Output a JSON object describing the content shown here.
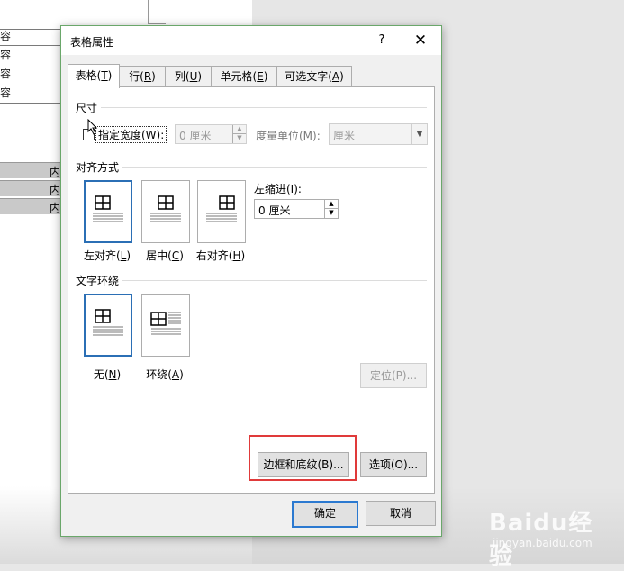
{
  "document": {
    "cells": [
      "容",
      "容",
      "容",
      "容"
    ],
    "gray_rows": [
      "内",
      "内",
      "内"
    ]
  },
  "dialog": {
    "title": "表格属性",
    "help": "?",
    "close": "✕",
    "tabs": [
      {
        "label": "表格",
        "mnemonic": "T"
      },
      {
        "label": "行",
        "mnemonic": "R"
      },
      {
        "label": "列",
        "mnemonic": "U"
      },
      {
        "label": "单元格",
        "mnemonic": "E"
      },
      {
        "label": "可选文字",
        "mnemonic": "A"
      }
    ],
    "size": {
      "section_label": "尺寸",
      "preferred_width_label": "指定宽度(W):",
      "preferred_width_checked": false,
      "width_value": "0 厘米",
      "unit_label": "度量单位(M):",
      "unit_value": "厘米"
    },
    "alignment": {
      "section_label": "对齐方式",
      "options": [
        {
          "label": "左对齐",
          "mnemonic": "L",
          "selected": true
        },
        {
          "label": "居中",
          "mnemonic": "C",
          "selected": false
        },
        {
          "label": "右对齐",
          "mnemonic": "H",
          "selected": false
        }
      ],
      "indent_label": "左缩进(I):",
      "indent_value": "0 厘米"
    },
    "wrapping": {
      "section_label": "文字环绕",
      "options": [
        {
          "label": "无",
          "mnemonic": "N",
          "selected": true
        },
        {
          "label": "环绕",
          "mnemonic": "A",
          "selected": false
        }
      ],
      "positioning_button": "定位(P)..."
    },
    "borders_button": "边框和底纹(B)...",
    "options_button": "选项(O)...",
    "ok_button": "确定",
    "cancel_button": "取消"
  },
  "watermark": {
    "brand": "Baidu经验",
    "url": "jingyan.baidu.com"
  },
  "colors": {
    "selection_blue": "#2b6fb5",
    "highlight_red": "#e03a3a",
    "dialog_border": "#6aa76a"
  }
}
